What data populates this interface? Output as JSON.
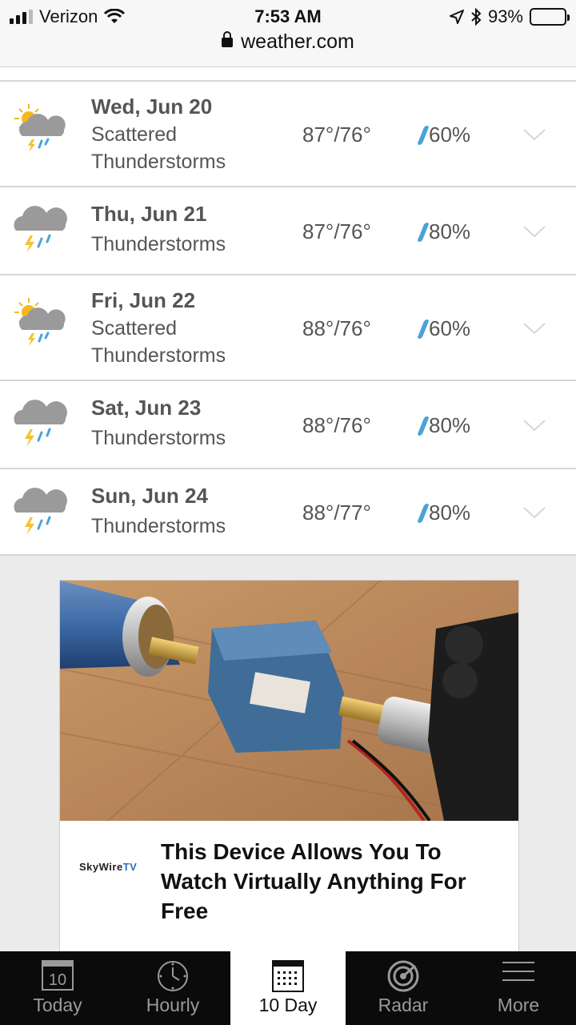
{
  "status_bar": {
    "carrier": "Verizon",
    "time": "7:53 AM",
    "battery": "93%",
    "battery_level": 0.93,
    "signal_bars_filled": 3
  },
  "browser": {
    "url": "weather.com"
  },
  "forecast": [
    {
      "date": "Wed, Jun 20",
      "condition": "Scattered Thunderstorms",
      "temp": "87°/76°",
      "precip": "60%",
      "icon": "scattered-thunderstorms-icon"
    },
    {
      "date": "Thu, Jun 21",
      "condition": "Thunderstorms",
      "temp": "87°/76°",
      "precip": "80%",
      "icon": "thunderstorms-icon"
    },
    {
      "date": "Fri, Jun 22",
      "condition": "Scattered Thunderstorms",
      "temp": "88°/76°",
      "precip": "60%",
      "icon": "scattered-thunderstorms-icon"
    },
    {
      "date": "Sat, Jun 23",
      "condition": "Thunderstorms",
      "temp": "88°/76°",
      "precip": "80%",
      "icon": "thunderstorms-icon"
    },
    {
      "date": "Sun, Jun 24",
      "condition": "Thunderstorms",
      "temp": "88°/77°",
      "precip": "80%",
      "icon": "thunderstorms-icon"
    }
  ],
  "ad": {
    "brand": "SkyWireTV",
    "brand_main": "SkyWire",
    "brand_tv": "TV",
    "title": "This Device Allows You To Watch Virtually Anything For Free"
  },
  "tabs": [
    {
      "label": "Today",
      "icon": "calendar-icon",
      "calendar_number": "10",
      "active": false
    },
    {
      "label": "Hourly",
      "icon": "clock-icon",
      "active": false
    },
    {
      "label": "10 Day",
      "icon": "calendar-grid-icon",
      "active": true
    },
    {
      "label": "Radar",
      "icon": "radar-icon",
      "active": false
    },
    {
      "label": "More",
      "icon": "menu-icon",
      "active": false
    }
  ],
  "colors": {
    "precip_drop": "#4aa3d8",
    "lightning": "#f2c12e",
    "sun": "#f5b820",
    "cloud": "#9a9a9a",
    "tabbar_bg": "#0b0b0b"
  }
}
